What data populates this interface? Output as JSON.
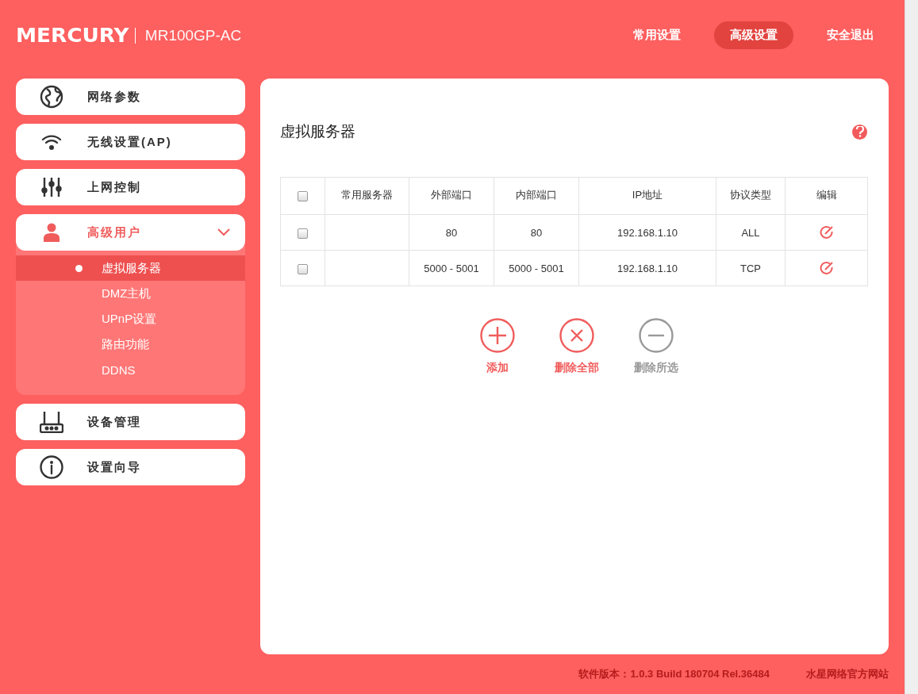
{
  "header": {
    "logo": "MERCURY",
    "model": "MR100GP-AC",
    "nav": [
      {
        "label": "常用设置",
        "selected": false
      },
      {
        "label": "高级设置",
        "selected": true
      },
      {
        "label": "安全退出",
        "selected": false
      }
    ]
  },
  "sidebar": {
    "items": [
      {
        "label": "网络参数",
        "kind": "globe",
        "selected": false,
        "expanded": false
      },
      {
        "label": "无线设置(AP)",
        "kind": "wifi",
        "selected": false,
        "expanded": false
      },
      {
        "label": "上网控制",
        "kind": "sliders",
        "selected": false,
        "expanded": false
      },
      {
        "label": "高级用户",
        "kind": "user",
        "selected": true,
        "expanded": true,
        "children": [
          {
            "label": "虚拟服务器",
            "selected": true
          },
          {
            "label": "DMZ主机",
            "selected": false
          },
          {
            "label": "UPnP设置",
            "selected": false
          },
          {
            "label": "路由功能",
            "selected": false
          },
          {
            "label": "DDNS",
            "selected": false
          }
        ]
      },
      {
        "label": "设备管理",
        "kind": "router",
        "selected": false,
        "expanded": false
      },
      {
        "label": "设置向导",
        "kind": "info",
        "selected": false,
        "expanded": false
      }
    ]
  },
  "panel": {
    "title": "虚拟服务器",
    "table": {
      "header_checked": false,
      "columns": [
        "常用服务器",
        "外部端口",
        "内部端口",
        "IP地址",
        "协议类型",
        "编辑"
      ],
      "rows": [
        {
          "checked": false,
          "cells": [
            "",
            "80",
            "80",
            "192.168.1.10",
            "ALL"
          ]
        },
        {
          "checked": false,
          "cells": [
            "",
            "5000 - 5001",
            "5000 - 5001",
            "192.168.1.10",
            "TCP"
          ]
        }
      ]
    },
    "actions": [
      {
        "label": "添加",
        "kind": "add",
        "disabled": false
      },
      {
        "label": "删除全部",
        "kind": "delete_all",
        "disabled": false
      },
      {
        "label": "删除所选",
        "kind": "delete_selected",
        "disabled": true
      }
    ]
  },
  "footer": {
    "version": "软件版本：1.0.3 Build 180704 Rel.36484",
    "link": "水星网络官方网站"
  }
}
